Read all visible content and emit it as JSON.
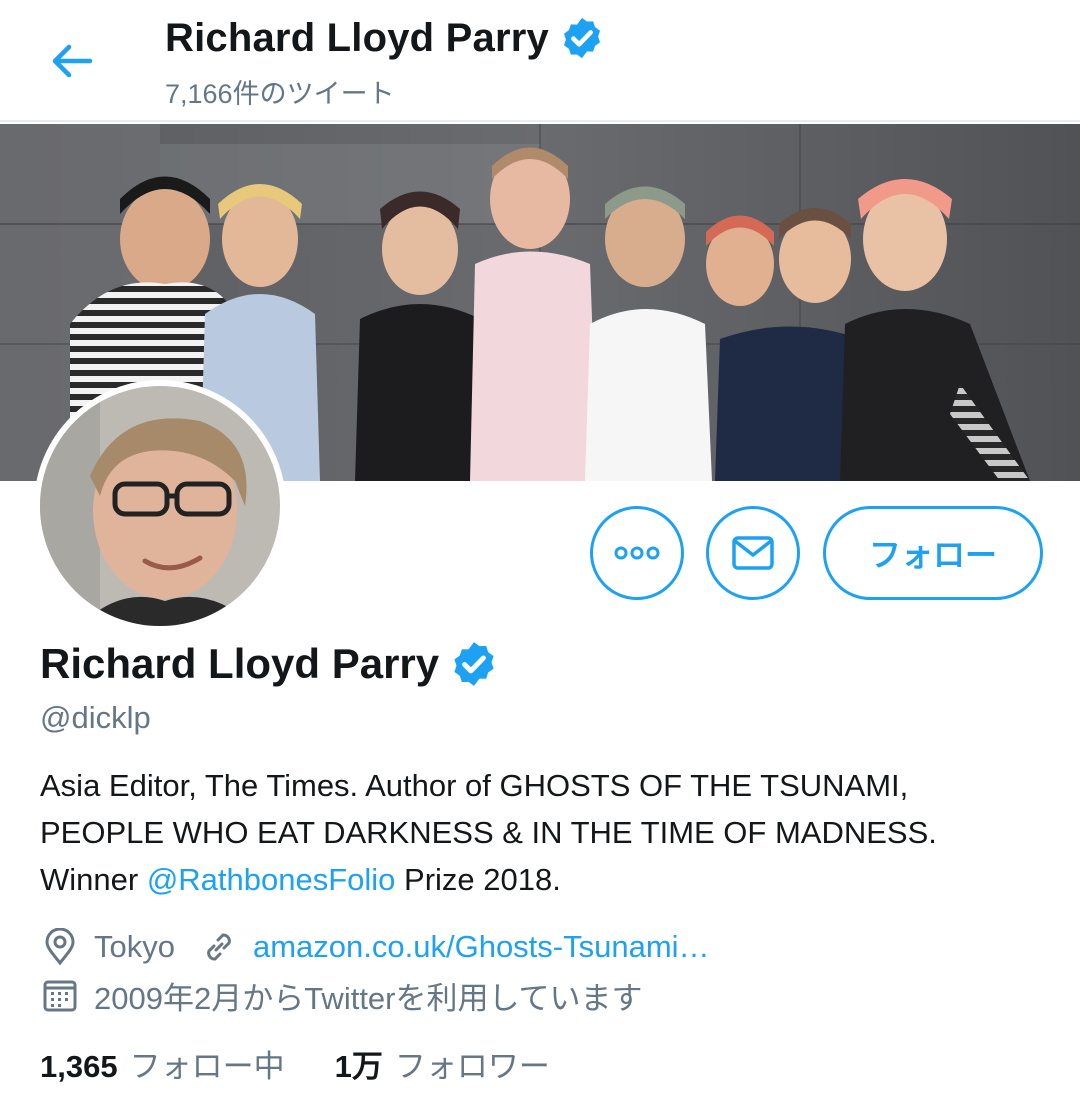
{
  "header": {
    "name": "Richard Lloyd Parry",
    "tweet_count": "7,166件のツイート"
  },
  "profile": {
    "name": "Richard Lloyd Parry",
    "handle": "@dicklp",
    "bio_line1": "Asia Editor, The Times. Author of GHOSTS OF THE TSUNAMI,",
    "bio_line2": "PEOPLE WHO EAT DARKNESS & IN THE TIME OF MADNESS.",
    "bio_line3_prefix": "Winner ",
    "bio_mention": "@RathbonesFolio",
    "bio_line3_suffix": " Prize 2018.",
    "location": "Tokyo",
    "website": "amazon.co.uk/Ghosts-Tsunami…",
    "joined": "2009年2月からTwitterを利用しています",
    "following_count": "1,365",
    "following_label": "フォロー中",
    "followers_count": "1万",
    "followers_label": "フォロワー"
  },
  "actions": {
    "follow_label": "フォロー"
  },
  "icons": {
    "back": "arrow-left-icon",
    "verified": "verified-badge-icon",
    "more": "more-dots-icon",
    "message": "envelope-icon",
    "location": "map-pin-icon",
    "link": "link-icon",
    "calendar": "calendar-icon"
  },
  "colors": {
    "accent": "#1da1f2",
    "secondary_text": "#657786",
    "primary_text": "#14171a"
  }
}
